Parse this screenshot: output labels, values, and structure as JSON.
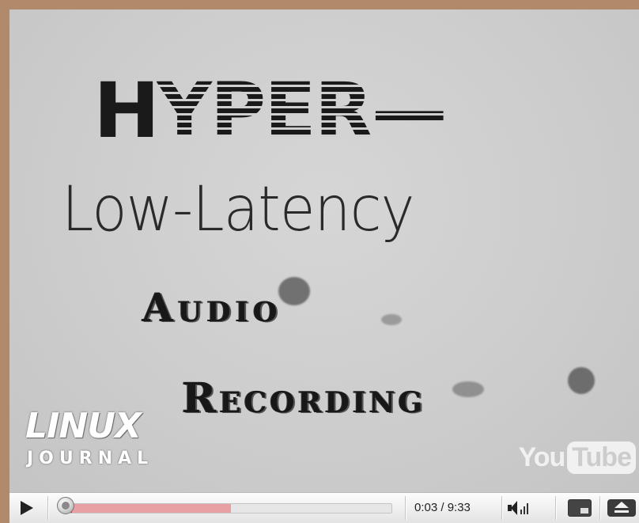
{
  "video": {
    "title_lines": {
      "line1_first": "H",
      "line1_rest": "YPER—",
      "line2": "Low-Latency",
      "line3": "Audio",
      "line4": "Recording"
    },
    "logo_left": {
      "top": "LINUX",
      "bottom": "JOURNAL"
    },
    "watermark": {
      "you": "You",
      "tube": "Tube"
    }
  },
  "controls": {
    "current_time": "0:03",
    "duration": "9:33",
    "time_display": "0:03 / 9:33",
    "progress_fraction": 0.005,
    "buffered_fraction": 0.5,
    "icons": [
      "play-icon",
      "seek-knob",
      "volume-icon",
      "player-size-icon",
      "eject-icon"
    ]
  },
  "colors": {
    "frame": "#b08a6a",
    "video_bg": "#cfcfcf",
    "progress": "#cc2a2a",
    "buffered": "#e8a0a4"
  }
}
